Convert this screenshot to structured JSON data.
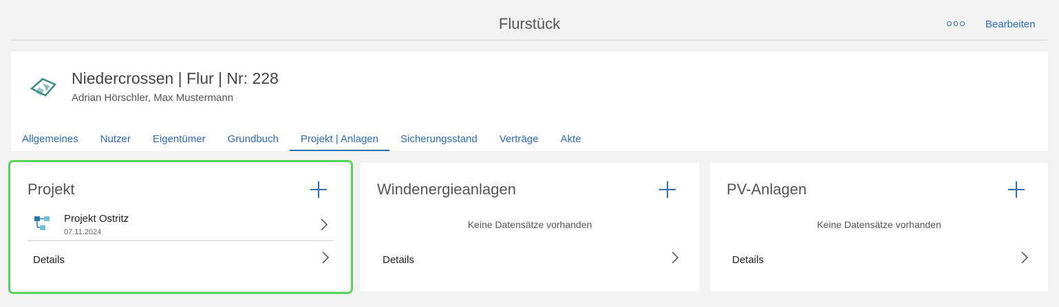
{
  "topbar": {
    "title": "Flurstück",
    "edit_label": "Bearbeiten"
  },
  "header": {
    "name": "Niedercrossen | Flur | Nr: 228",
    "owners": "Adrian Hörschler, Max Mustermann",
    "tabs": [
      {
        "label": "Allgemeines"
      },
      {
        "label": "Nutzer"
      },
      {
        "label": "Eigentümer"
      },
      {
        "label": "Grundbuch"
      },
      {
        "label": "Projekt | Anlagen",
        "active": true
      },
      {
        "label": "Sicherungsstand"
      },
      {
        "label": "Verträge"
      },
      {
        "label": "Akte"
      }
    ]
  },
  "cards": {
    "projekt": {
      "title": "Projekt",
      "item": {
        "name": "Projekt Ostritz",
        "date": "07.11.2024"
      },
      "details_label": "Details"
    },
    "wind": {
      "title": "Windenergieanlagen",
      "empty_text": "Keine Datensätze vorhanden",
      "details_label": "Details"
    },
    "pv": {
      "title": "PV-Anlagen",
      "empty_text": "Keine Datensätze vorhanden",
      "details_label": "Details"
    }
  },
  "colors": {
    "accent": "#2e6db4",
    "highlight_outline": "#5ad35a",
    "icon_teal": "#3e8a84"
  }
}
